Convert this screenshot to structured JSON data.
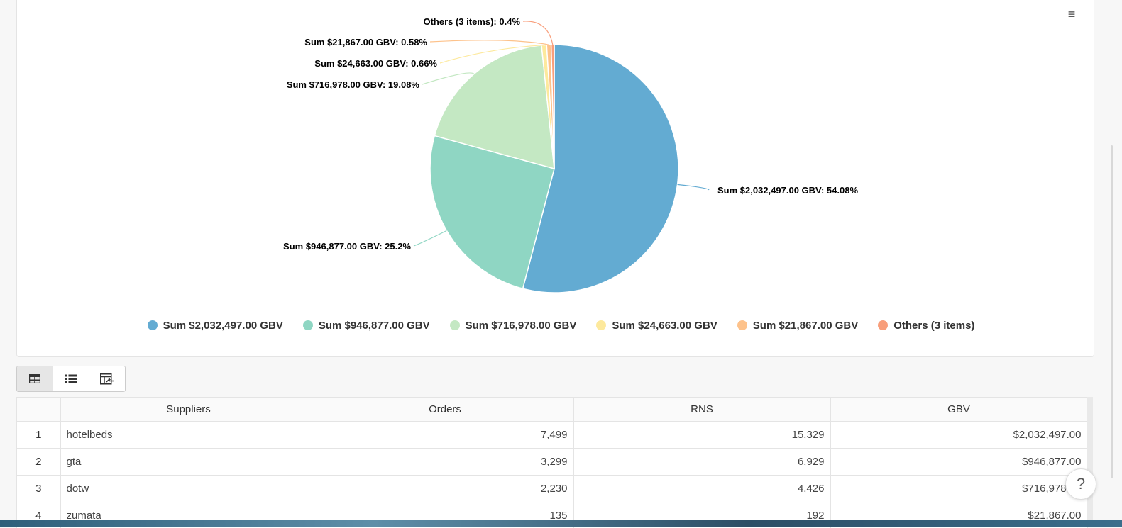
{
  "toolbar": {
    "menu_icon": "hamburger-icon",
    "menu_glyph": "≡"
  },
  "chart_data": {
    "type": "pie",
    "slices": [
      {
        "label": "Sum $2,032,497.00 GBV",
        "data_label": "Sum $2,032,497.00 GBV: 54.08%",
        "percent": 54.08,
        "color": "#63abd2"
      },
      {
        "label": "Sum $946,877.00 GBV",
        "data_label": "Sum $946,877.00 GBV: 25.2%",
        "percent": 25.2,
        "color": "#8fd6c3"
      },
      {
        "label": "Sum $716,978.00 GBV",
        "data_label": "Sum $716,978.00 GBV: 19.08%",
        "percent": 19.08,
        "color": "#c4e8c3"
      },
      {
        "label": "Sum $24,663.00 GBV",
        "data_label": "Sum $24,663.00 GBV: 0.66%",
        "percent": 0.66,
        "color": "#fde99d"
      },
      {
        "label": "Sum $21,867.00 GBV",
        "data_label": "Sum $21,867.00 GBV: 0.58%",
        "percent": 0.58,
        "color": "#fdc28b"
      },
      {
        "label": "Others (3 items)",
        "data_label": "Others (3 items): 0.4%",
        "percent": 0.4,
        "color": "#f89e7b"
      }
    ],
    "legend_position": "bottom"
  },
  "view_toggle": {
    "buttons": [
      {
        "icon": "table-grid-icon",
        "active": true
      },
      {
        "icon": "list-icon",
        "active": false
      },
      {
        "icon": "table-export-icon",
        "active": false
      }
    ]
  },
  "table": {
    "columns": [
      "Suppliers",
      "Orders",
      "RNS",
      "GBV"
    ],
    "rows": [
      {
        "index": "1",
        "supplier": "hotelbeds",
        "orders": "7,499",
        "rns": "15,329",
        "gbv": "$2,032,497.00"
      },
      {
        "index": "2",
        "supplier": "gta",
        "orders": "3,299",
        "rns": "6,929",
        "gbv": "$946,877.00"
      },
      {
        "index": "3",
        "supplier": "dotw",
        "orders": "2,230",
        "rns": "4,426",
        "gbv": "$716,978.00"
      },
      {
        "index": "4",
        "supplier": "zumata",
        "orders": "135",
        "rns": "192",
        "gbv": "$21,867.00"
      }
    ]
  },
  "help": {
    "glyph": "?"
  }
}
